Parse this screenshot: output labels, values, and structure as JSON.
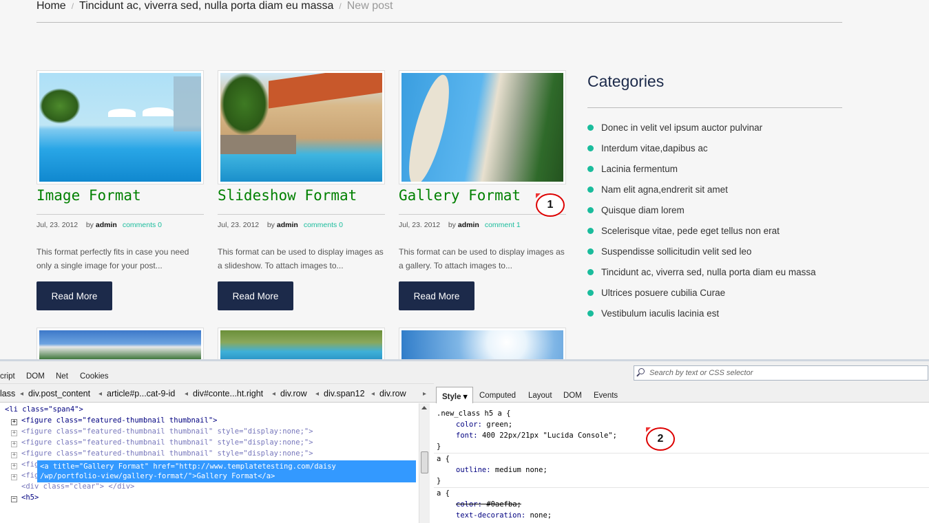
{
  "breadcrumb": {
    "home": "Home",
    "parent": "Tincidunt ac, viverra sed, nulla porta diam eu massa",
    "current": "New post"
  },
  "posts": [
    {
      "title": "Image Format",
      "date": "Jul, 23. 2012",
      "by": "by",
      "author": "admin",
      "comments": "comments 0",
      "excerpt": "This format perfectly fits in case you need only a single image for your post...",
      "button": "Read More"
    },
    {
      "title": "Slideshow Format",
      "date": "Jul, 23. 2012",
      "by": "by",
      "author": "admin",
      "comments": "comments 0",
      "excerpt": "This format can be used to display images as a slideshow. To attach images to...",
      "button": "Read More"
    },
    {
      "title": "Gallery Format",
      "date": "Jul, 23. 2012",
      "by": "by",
      "author": "admin",
      "comments": "comment 1",
      "excerpt": "This format can be used to display images as a gallery. To attach images to...",
      "button": "Read More"
    }
  ],
  "sidebar": {
    "title": "Categories",
    "items": [
      "Donec in velit vel ipsum auctor pulvinar",
      "Interdum vitae,dapibus ac",
      "Lacinia fermentum",
      "Nam elit agna,endrerit sit amet",
      "Quisque diam lorem",
      "Scelerisque vitae, pede eget tellus non erat",
      "Suspendisse sollicitudin velit sed leo",
      "Tincidunt ac, viverra sed, nulla porta diam eu massa",
      "Ultrices posuere cubilia Curae",
      "Vestibulum iaculis lacinia est"
    ]
  },
  "callouts": {
    "one": "1",
    "two": "2"
  },
  "devtools": {
    "tabs": [
      "cript",
      "DOM",
      "Net",
      "Cookies"
    ],
    "search_placeholder": "Search by text or CSS selector",
    "crumbs": [
      "lass",
      "div.post_content",
      "article#p...cat-9-id",
      "div#conte...ht.right",
      "div.row",
      "div.span12",
      "div.row"
    ],
    "side_tabs": [
      "Style",
      "Computed",
      "Layout",
      "DOM",
      "Events"
    ],
    "html": {
      "li_open": "<li class=\"span4\">",
      "fig_first": "<figure class=\"featured-thumbnail thumbnail\">",
      "fig_hidden": "<figure class=\"featured-thumbnail thumbnail\" style=\"display:none;\">",
      "clear": "<div class=\"clear\"> </div>",
      "h5": "<h5>",
      "selected_line1": "<a title=\"Gallery Format\" href=\"http://www.templatetesting.com/daisy",
      "selected_line2": "/wp/portfolio-view/gallery-format/\">Gallery Format</a>"
    },
    "css": {
      "rule1_selector": ".new_class h5 a {",
      "rule1_p1_name": "color:",
      "rule1_p1_val": "green;",
      "rule1_p2_name": "font:",
      "rule1_p2_val": "400 22px/21px \"Lucida Console\";",
      "close": "}",
      "rule2_selector": "a {",
      "rule2_p1_name": "outline:",
      "rule2_p1_val": "medium none;",
      "rule3_selector": "a {",
      "rule3_p1_name": "color:",
      "rule3_p1_val": "#0aefba;",
      "rule3_p2_name": "text-decoration:",
      "rule3_p2_val": "none;"
    }
  },
  "colors": {
    "accent": "#1abc9c",
    "button": "#1c2a4a",
    "title": "#008000",
    "callout_ring": "#dd0000"
  }
}
